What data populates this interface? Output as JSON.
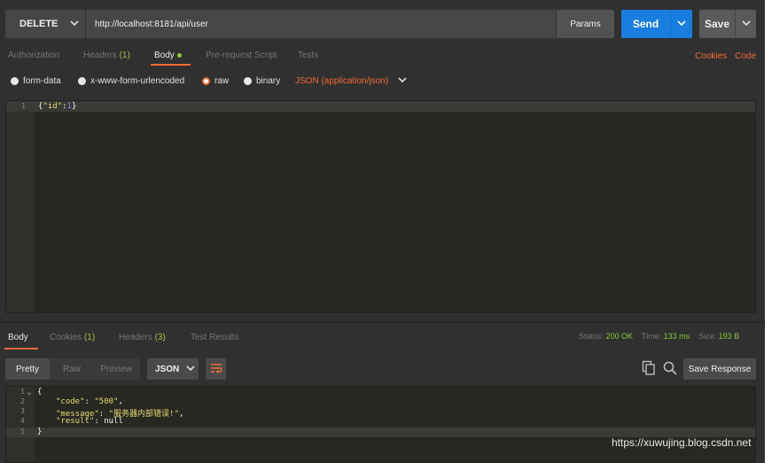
{
  "request": {
    "method": "DELETE",
    "url": "http://localhost:8181/api/user",
    "params_label": "Params",
    "send_label": "Send",
    "save_label": "Save"
  },
  "request_tabs": {
    "authorization": "Authorization",
    "headers": "Headers",
    "headers_count": "(1)",
    "body": "Body",
    "prerequest": "Pre-request Script",
    "tests": "Tests",
    "cookies_link": "Cookies",
    "code_link": "Code"
  },
  "body_types": {
    "form_data": "form-data",
    "urlencoded": "x-www-form-urlencoded",
    "raw": "raw",
    "binary": "binary",
    "content_type": "JSON (application/json)"
  },
  "request_body": {
    "line_number": "1",
    "brace_open": "{",
    "key": "\"id\"",
    "colon": ":",
    "value": "1",
    "brace_close": "}"
  },
  "response_tabs": {
    "body": "Body",
    "cookies": "Cookies",
    "cookies_count": "(1)",
    "headers": "Headers",
    "headers_count": "(3)",
    "test_results": "Test Results"
  },
  "response_status": {
    "status_label": "Status:",
    "status_value": "200 OK",
    "time_label": "Time:",
    "time_value": "133 ms",
    "size_label": "Size:",
    "size_value": "193 B"
  },
  "response_toolbar": {
    "pretty": "Pretty",
    "raw": "Raw",
    "preview": "Preview",
    "format": "JSON",
    "save_response": "Save Response"
  },
  "response_body": {
    "line_numbers": [
      "1",
      "2",
      "3",
      "4",
      "5"
    ],
    "open": "{",
    "code_key": "\"code\"",
    "code_value": "\"500\"",
    "message_key": "\"message\"",
    "message_value": "\"服务器内部错误!\"",
    "result_key": "\"result\"",
    "result_value": "null",
    "close": "}"
  },
  "watermark": "https://xuwujing.blog.csdn.net",
  "colors": {
    "accent": "#f26b3a",
    "send_blue": "#1a7de0",
    "status_green": "#8cc63f"
  }
}
